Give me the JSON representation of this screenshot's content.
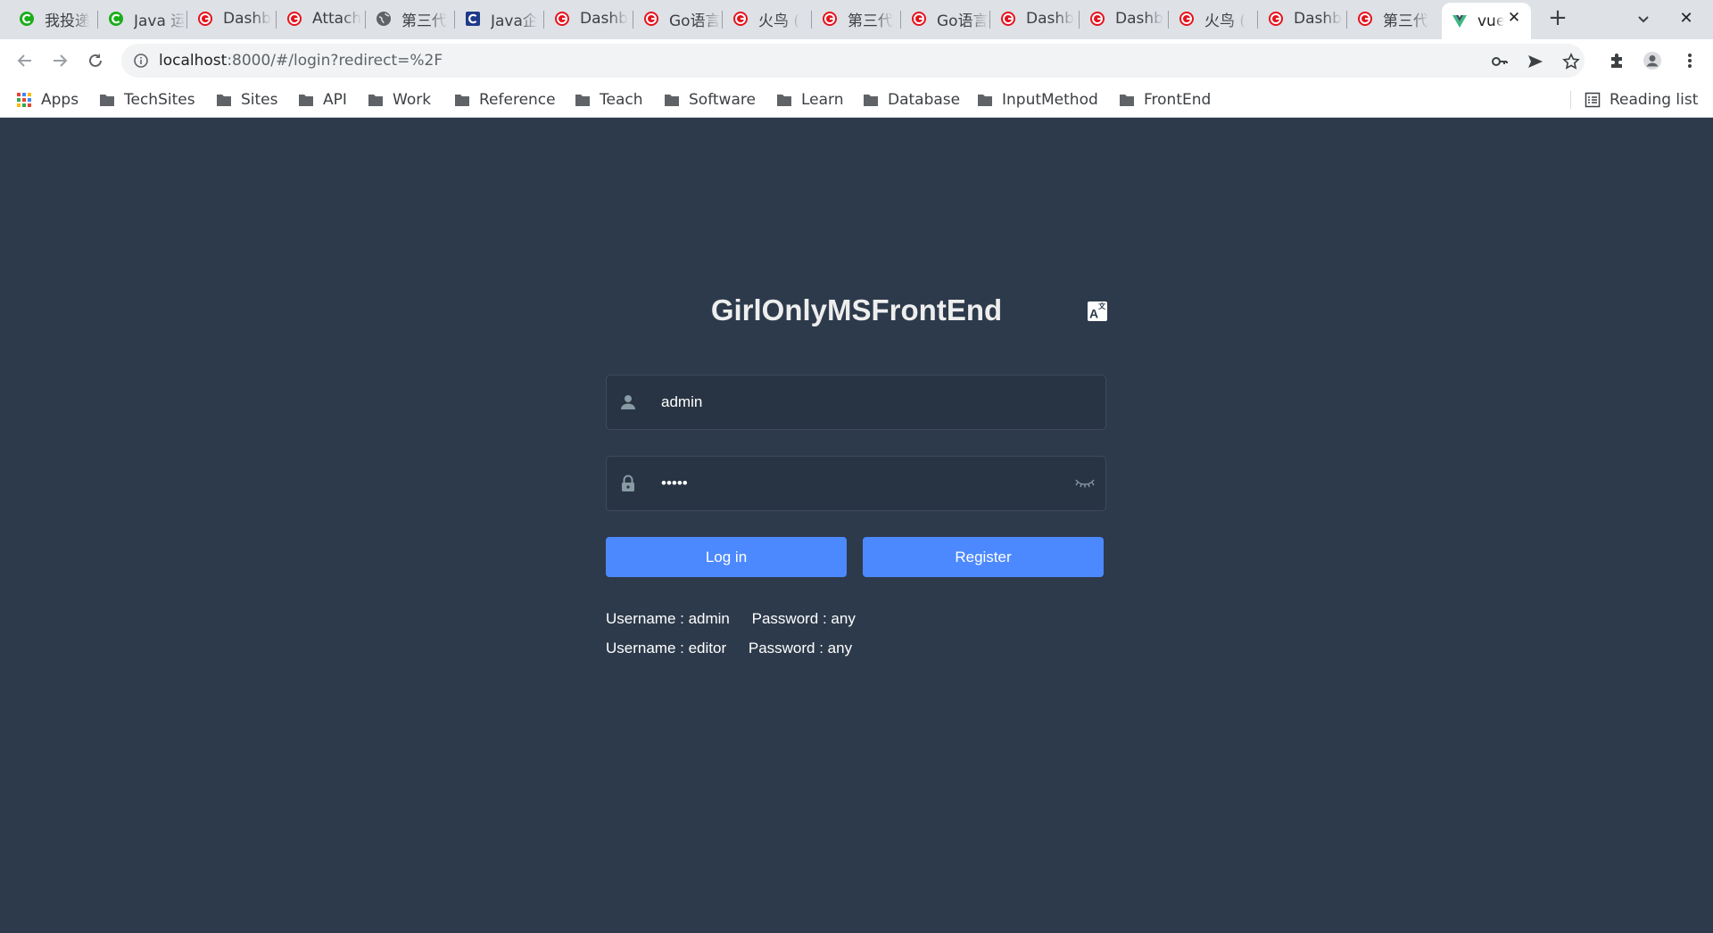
{
  "browser": {
    "tabs": [
      {
        "title": "我投递",
        "icon": "green-c-icon"
      },
      {
        "title": "Java 运",
        "icon": "green-c-icon"
      },
      {
        "title": "Dashb",
        "icon": "red-g-icon"
      },
      {
        "title": "Attach",
        "icon": "red-g-icon"
      },
      {
        "title": "第三代",
        "icon": "globe-icon"
      },
      {
        "title": "Java企",
        "icon": "blue-c-icon"
      },
      {
        "title": "Dashb",
        "icon": "red-g-icon"
      },
      {
        "title": "Go语言",
        "icon": "red-g-icon"
      },
      {
        "title": "火鸟 (",
        "icon": "red-g-icon"
      },
      {
        "title": "第三代",
        "icon": "red-g-icon"
      },
      {
        "title": "Go语言",
        "icon": "red-g-icon"
      },
      {
        "title": "Dashb",
        "icon": "red-g-icon"
      },
      {
        "title": "Dashb",
        "icon": "red-g-icon"
      },
      {
        "title": "火鸟 (",
        "icon": "red-g-icon"
      },
      {
        "title": "Dashb",
        "icon": "red-g-icon"
      },
      {
        "title": "第三代",
        "icon": "red-g-icon"
      },
      {
        "title": "vue",
        "icon": "vue-icon",
        "active": true
      }
    ],
    "new_tab_label": "+",
    "url": {
      "host": "localhost",
      "rest": ":8000/#/login?redirect=%2F"
    },
    "bookmarks": [
      {
        "label": "Apps",
        "icon": "apps-grid-icon"
      },
      {
        "label": "TechSites",
        "icon": "folder-icon"
      },
      {
        "label": "Sites",
        "icon": "folder-icon"
      },
      {
        "label": "API",
        "icon": "folder-icon"
      },
      {
        "label": "Work",
        "icon": "folder-icon"
      },
      {
        "label": "Reference",
        "icon": "folder-icon"
      },
      {
        "label": "Teach",
        "icon": "folder-icon"
      },
      {
        "label": "Software",
        "icon": "folder-icon"
      },
      {
        "label": "Learn",
        "icon": "folder-icon"
      },
      {
        "label": "Database",
        "icon": "folder-icon"
      },
      {
        "label": "InputMethod",
        "icon": "folder-icon"
      },
      {
        "label": "FrontEnd",
        "icon": "folder-icon"
      }
    ],
    "reading_list": "Reading list"
  },
  "login": {
    "title": "GirlOnlyMSFrontEnd",
    "lang_icon_label": "A",
    "lang_icon_sup": "文",
    "username_value": "admin",
    "password_value": "•••••",
    "login_button": "Log in",
    "register_button": "Register",
    "tips": [
      {
        "user": "Username : admin",
        "pass": "Password : any"
      },
      {
        "user": "Username : editor",
        "pass": "Password : any"
      }
    ]
  },
  "colors": {
    "page_background": "#2d3a4b",
    "input_background": "#283443",
    "button_primary": "#4d89fe",
    "title_text": "#eeeeee"
  }
}
